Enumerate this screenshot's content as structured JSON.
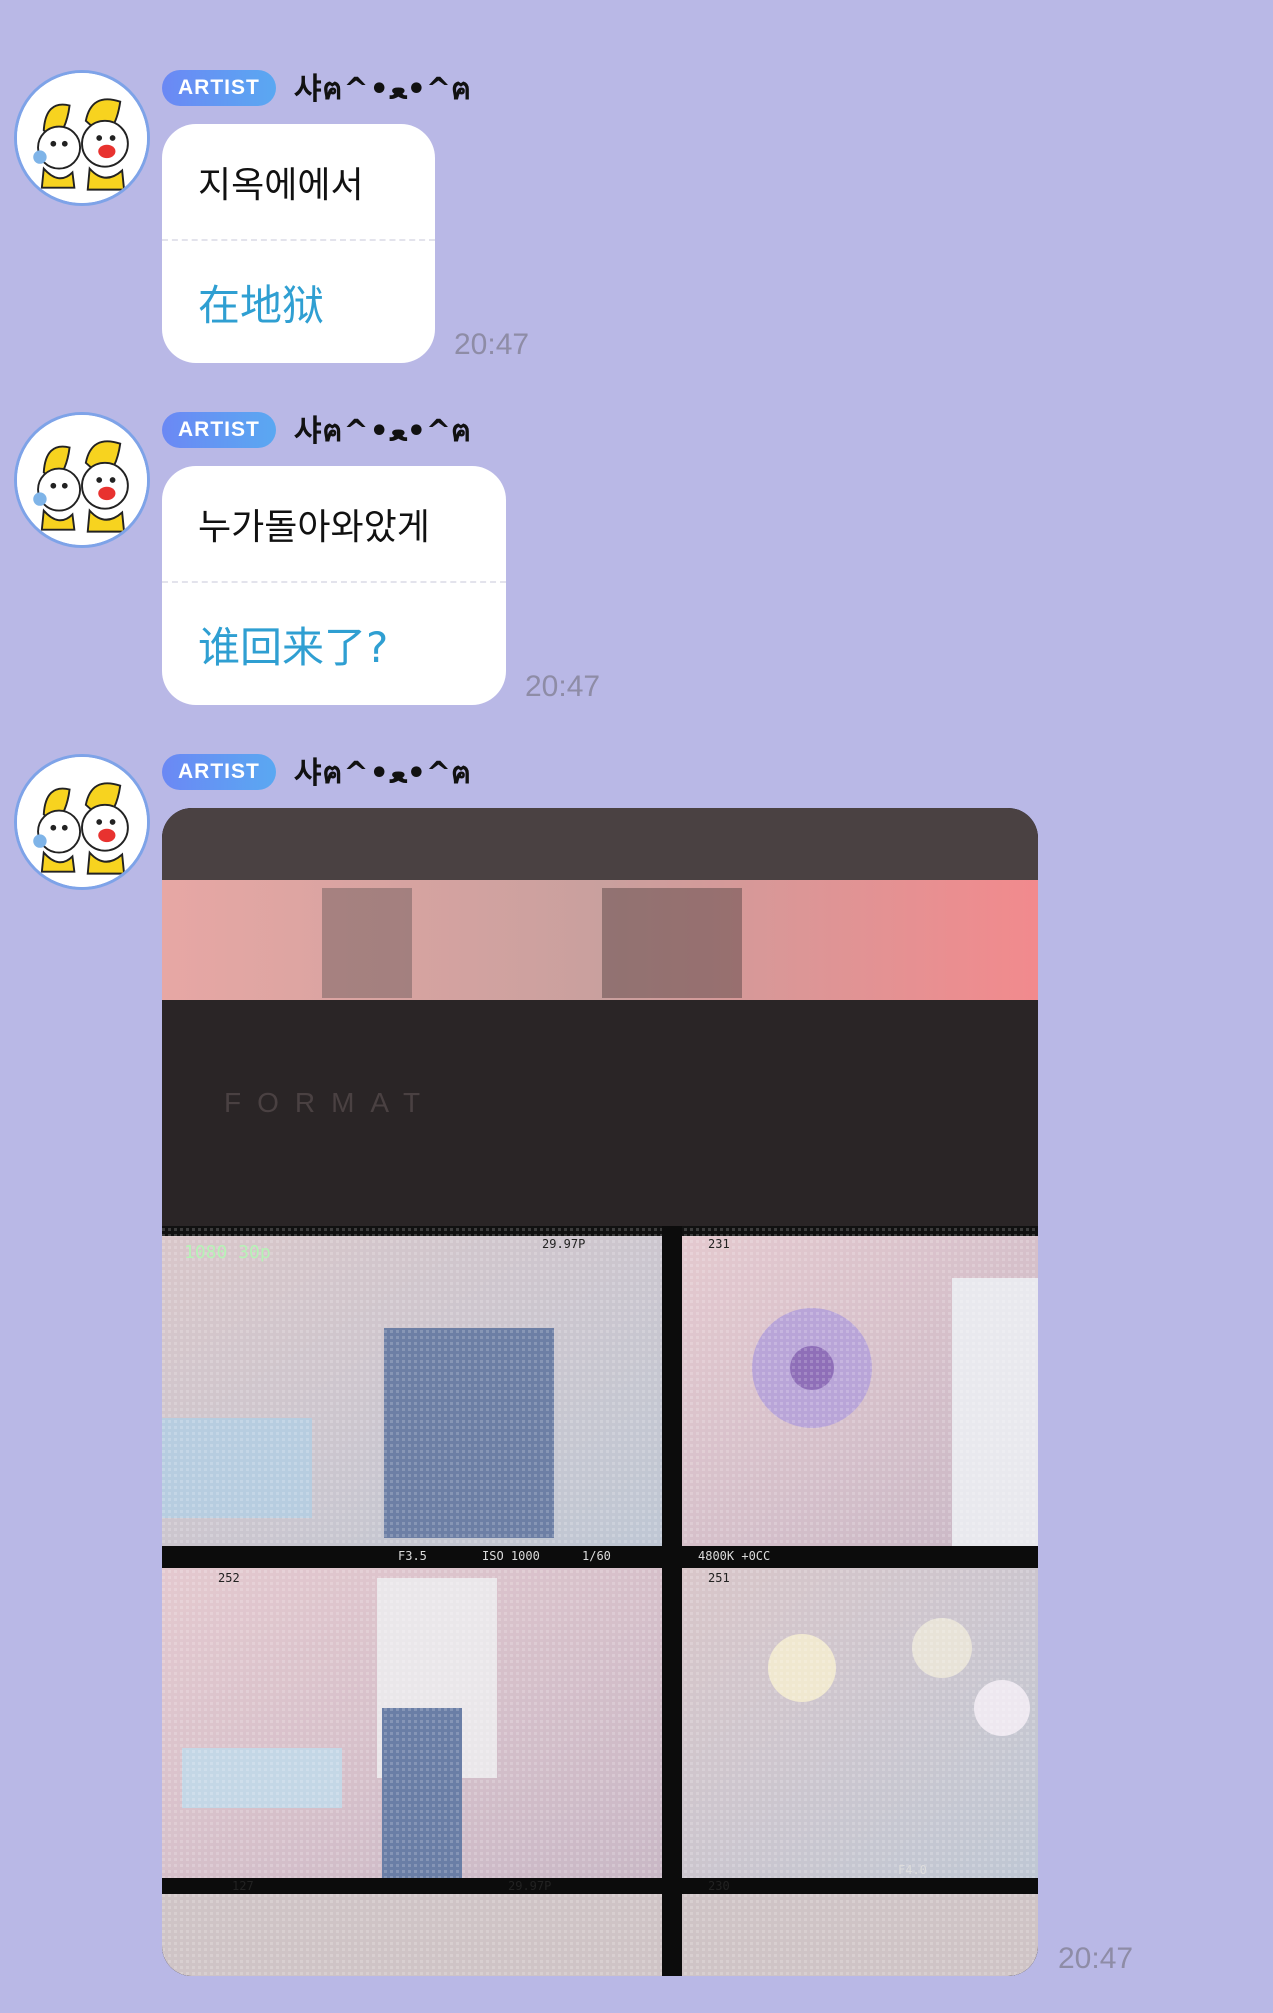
{
  "messages": [
    {
      "badge": "ARTIST",
      "nickname": "샤ฅ^•ﻌ•^ฅ",
      "original": "지옥에에서",
      "translation": "在地狱",
      "time": "20:47"
    },
    {
      "badge": "ARTIST",
      "nickname": "샤ฅ^•ﻌ•^ฅ",
      "original": "누가돌아와았게",
      "translation": "谁回来了?",
      "time": "20:47"
    },
    {
      "badge": "ARTIST",
      "nickname": "샤ฅ^•ﻌ•^ฅ",
      "image": {
        "top_text": "FORMAT",
        "monitor_readouts": [
          "1080 30p",
          "29.97P",
          "231",
          "252",
          "251",
          "29.97P",
          "127",
          "230",
          "4800K +0CC",
          "F3.5",
          "ISO 1000",
          "1/60",
          "F4.0"
        ]
      },
      "time": "20:47"
    }
  ],
  "colors": {
    "background": "#b9b8e6",
    "badge_start": "#6b88f4",
    "badge_end": "#5aa8f2",
    "translation": "#2f9fd2",
    "time": "#8e8ca6",
    "avatar_ring": "#7ea3e8"
  },
  "icons": [
    "avatar-image"
  ]
}
